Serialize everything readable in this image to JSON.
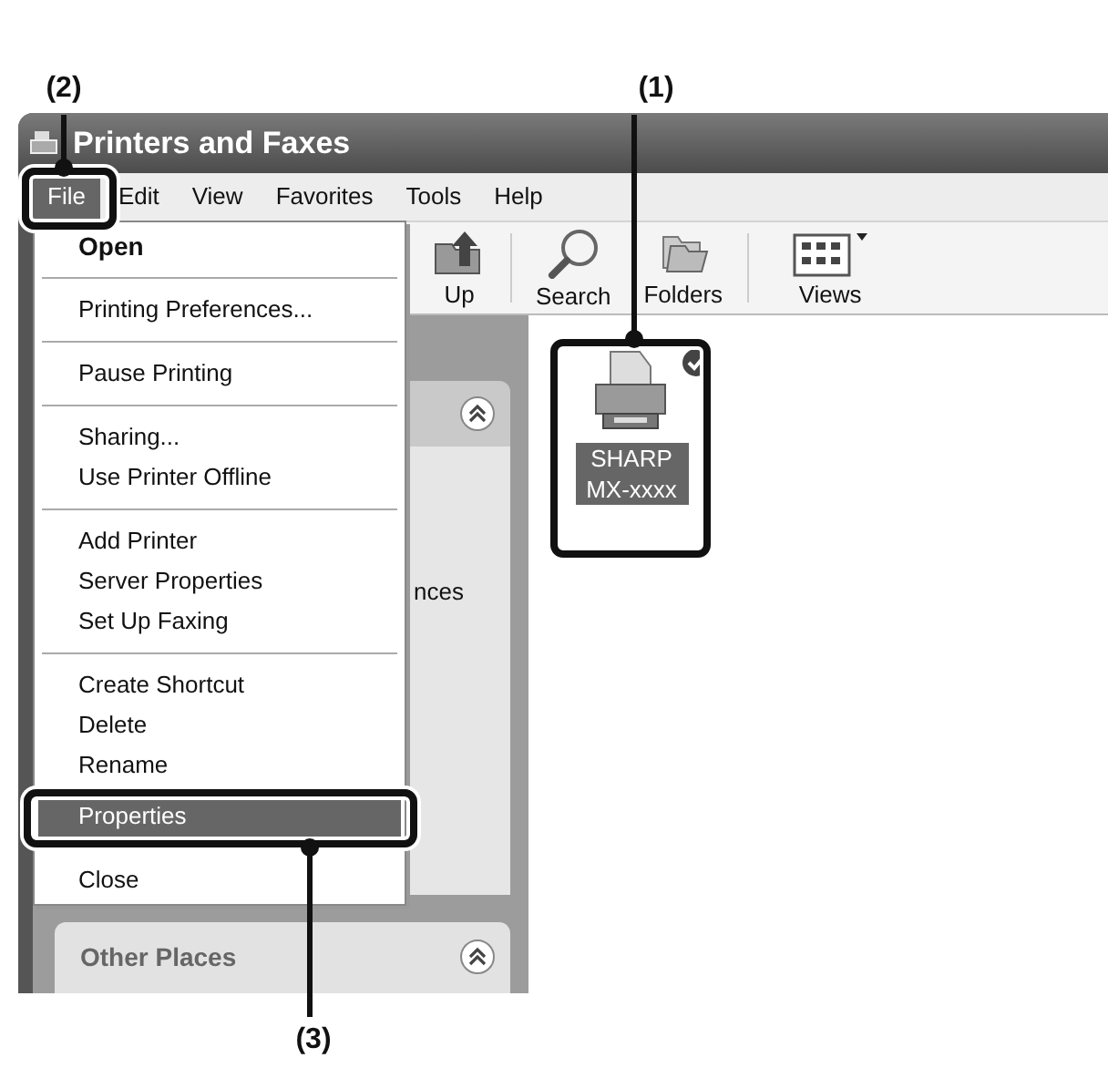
{
  "callouts": [
    {
      "label": "(2)"
    },
    {
      "label": "(1)"
    },
    {
      "label": "(3)"
    }
  ],
  "window": {
    "title": "Printers and Faxes"
  },
  "menubar": [
    {
      "label": "File",
      "selected": true
    },
    {
      "label": "Edit",
      "selected": false
    },
    {
      "label": "View",
      "selected": false
    },
    {
      "label": "Favorites",
      "selected": false
    },
    {
      "label": "Tools",
      "selected": false
    },
    {
      "label": "Help",
      "selected": false
    }
  ],
  "toolbar": [
    {
      "label": "Up",
      "kind": "up"
    },
    {
      "label": "Search",
      "kind": "search"
    },
    {
      "label": "Folders",
      "kind": "folders"
    },
    {
      "label": "Views",
      "kind": "views"
    }
  ],
  "task_pane": {
    "partial_text": "nces",
    "other_places": {
      "title": "Other Places"
    }
  },
  "file_menu": {
    "groups": [
      [
        {
          "label": "Open",
          "default": true,
          "selected": false
        }
      ],
      [
        {
          "label": "Printing Preferences...",
          "default": false,
          "selected": false
        }
      ],
      [
        {
          "label": "Pause Printing",
          "default": false,
          "selected": false
        }
      ],
      [
        {
          "label": "Sharing...",
          "default": false,
          "selected": false
        },
        {
          "label": "Use Printer Offline",
          "default": false,
          "selected": false
        }
      ],
      [
        {
          "label": "Add Printer",
          "default": false,
          "selected": false
        },
        {
          "label": "Server Properties",
          "default": false,
          "selected": false
        },
        {
          "label": "Set Up Faxing",
          "default": false,
          "selected": false
        }
      ],
      [
        {
          "label": "Create Shortcut",
          "default": false,
          "selected": false
        },
        {
          "label": "Delete",
          "default": false,
          "selected": false
        },
        {
          "label": "Rename",
          "default": false,
          "selected": false
        },
        {
          "label": "Properties",
          "default": false,
          "selected": true
        }
      ],
      [
        {
          "label": "Close",
          "default": false,
          "selected": false
        }
      ]
    ]
  },
  "printers": [
    {
      "label": "SHARP MX-xxxx",
      "selected": true,
      "default": true
    }
  ]
}
